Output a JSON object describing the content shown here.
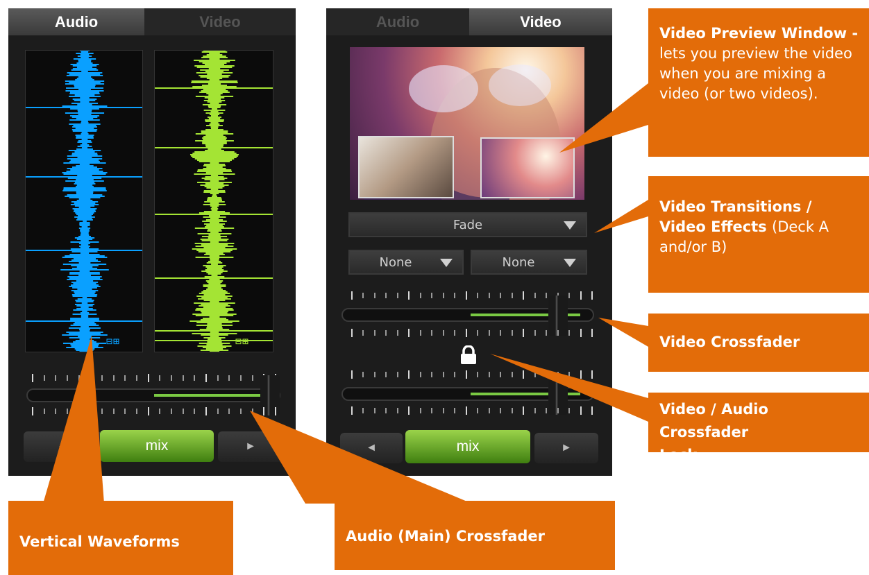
{
  "left_panel": {
    "tabs": [
      {
        "label": "Audio",
        "active": true
      },
      {
        "label": "Video",
        "active": false
      }
    ],
    "deck_a_color": "#0aa0ff",
    "deck_b_color": "#a4e434",
    "crossfader_position": 0.98,
    "buttons": {
      "prev": "◄",
      "mix": "mix",
      "next": "►"
    }
  },
  "right_panel": {
    "tabs": [
      {
        "label": "Audio",
        "active": false
      },
      {
        "label": "Video",
        "active": true
      }
    ],
    "transition": {
      "selected": "Fade"
    },
    "effect_a": {
      "selected": "None"
    },
    "effect_b": {
      "selected": "None"
    },
    "video_crossfader_position": 0.98,
    "audio_crossfader_position": 0.98,
    "lock_icon": "lock-icon",
    "buttons": {
      "prev": "◄",
      "mix": "mix",
      "next": "►"
    }
  },
  "callouts": {
    "preview_title": "Video Preview Window -",
    "preview_text": "lets you preview the video when you are mixing a video (or two videos).",
    "transitions_title": "Video Transitions / Video Effects",
    "transitions_text": "(Deck A and/or B)",
    "video_crossfader": "Video Crossfader",
    "lock": "Video / Audio Crossfader Lock",
    "waveforms": "Vertical Waveforms",
    "main_crossfader": "Audio (Main) Crossfader"
  },
  "colors": {
    "callout": "#e36c09",
    "accent_green": "#7ac943"
  }
}
